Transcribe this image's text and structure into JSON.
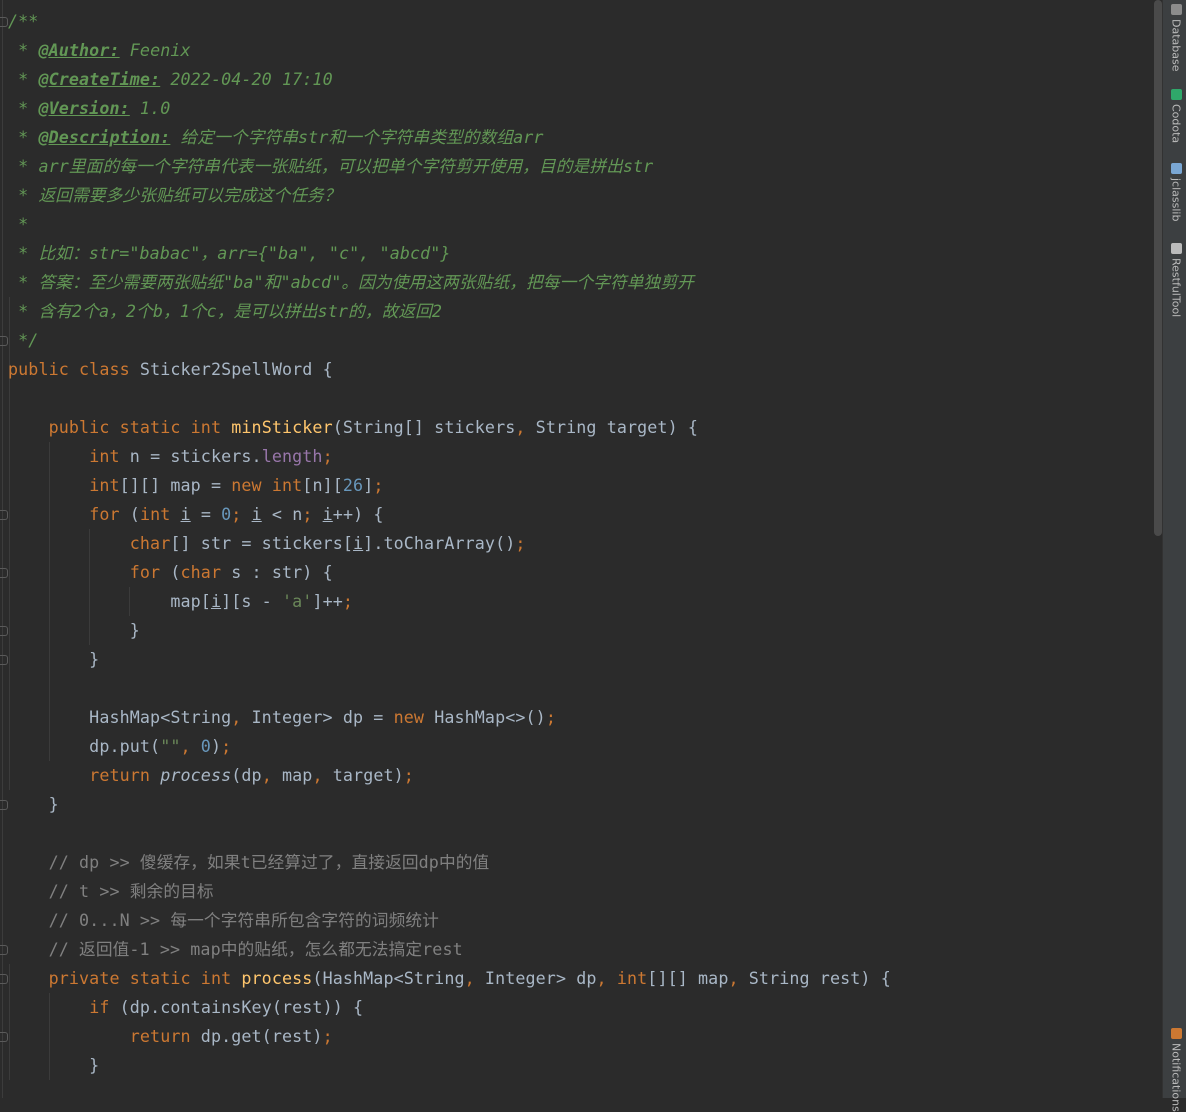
{
  "editor": {
    "lines": [
      [
        {
          "t": "/**",
          "c": "doc"
        }
      ],
      [
        {
          "t": " * ",
          "c": "doc"
        },
        {
          "t": "@Author:",
          "c": "tag"
        },
        {
          "t": " Feenix",
          "c": "doc"
        }
      ],
      [
        {
          "t": " * ",
          "c": "doc"
        },
        {
          "t": "@CreateTime:",
          "c": "tag"
        },
        {
          "t": " 2022-04-20 17:10",
          "c": "doc"
        }
      ],
      [
        {
          "t": " * ",
          "c": "doc"
        },
        {
          "t": "@Version:",
          "c": "tag"
        },
        {
          "t": " 1.0",
          "c": "doc"
        }
      ],
      [
        {
          "t": " * ",
          "c": "doc"
        },
        {
          "t": "@Description:",
          "c": "tag"
        },
        {
          "t": " 给定一个字符串str和一个字符串类型的数组arr",
          "c": "doc"
        }
      ],
      [
        {
          "t": " * arr里面的每一个字符串代表一张贴纸，可以把单个字符剪开使用，目的是拼出str",
          "c": "doc"
        }
      ],
      [
        {
          "t": " * 返回需要多少张贴纸可以完成这个任务？",
          "c": "doc"
        }
      ],
      [
        {
          "t": " *",
          "c": "doc"
        }
      ],
      [
        {
          "t": " * 比如：str=\"babac\"，arr={\"ba\", \"c\", \"abcd\"}",
          "c": "doc"
        }
      ],
      [
        {
          "t": " * 答案：至少需要两张贴纸\"ba\"和\"abcd\"。因为使用这两张贴纸，把每一个字符单独剪开",
          "c": "doc"
        }
      ],
      [
        {
          "t": " * 含有2个a，2个b，1个c，是可以拼出str的，故返回2",
          "c": "doc"
        }
      ],
      [
        {
          "t": " */",
          "c": "doc"
        }
      ],
      [
        {
          "t": "public class ",
          "c": "kw"
        },
        {
          "t": "Sticker2SpellWord {",
          "c": ""
        }
      ],
      [],
      [
        {
          "t": "    "
        },
        {
          "t": "public static int ",
          "c": "kw"
        },
        {
          "t": "minSticker",
          "c": "fn"
        },
        {
          "t": "(String[] stickers"
        },
        {
          "t": ", ",
          "c": "kw"
        },
        {
          "t": "String target) {"
        }
      ],
      [
        {
          "t": "        "
        },
        {
          "t": "int ",
          "c": "kw"
        },
        {
          "t": "n = stickers."
        },
        {
          "t": "length",
          "c": "field"
        },
        {
          "t": ";",
          "c": "kw"
        }
      ],
      [
        {
          "t": "        "
        },
        {
          "t": "int",
          "c": "kw"
        },
        {
          "t": "[][] map = "
        },
        {
          "t": "new int",
          "c": "kw"
        },
        {
          "t": "[n]["
        },
        {
          "t": "26",
          "c": "num"
        },
        {
          "t": "]"
        },
        {
          "t": ";",
          "c": "kw"
        }
      ],
      [
        {
          "t": "        "
        },
        {
          "t": "for ",
          "c": "kw"
        },
        {
          "t": "("
        },
        {
          "t": "int ",
          "c": "kw"
        },
        {
          "t": "i",
          "c": "ul"
        },
        {
          "t": " = "
        },
        {
          "t": "0",
          "c": "num"
        },
        {
          "t": "; ",
          "c": "kw"
        },
        {
          "t": "i",
          "c": "ul"
        },
        {
          "t": " < n"
        },
        {
          "t": "; ",
          "c": "kw"
        },
        {
          "t": "i",
          "c": "ul"
        },
        {
          "t": "++) {"
        }
      ],
      [
        {
          "t": "            "
        },
        {
          "t": "char",
          "c": "kw"
        },
        {
          "t": "[] str = stickers["
        },
        {
          "t": "i",
          "c": "ul"
        },
        {
          "t": "].toCharArray()"
        },
        {
          "t": ";",
          "c": "kw"
        }
      ],
      [
        {
          "t": "            "
        },
        {
          "t": "for ",
          "c": "kw"
        },
        {
          "t": "("
        },
        {
          "t": "char ",
          "c": "kw"
        },
        {
          "t": "s : str) {"
        }
      ],
      [
        {
          "t": "                map["
        },
        {
          "t": "i",
          "c": "ul"
        },
        {
          "t": "][s - "
        },
        {
          "t": "'a'",
          "c": "str"
        },
        {
          "t": "]++"
        },
        {
          "t": ";",
          "c": "kw"
        }
      ],
      [
        {
          "t": "            }"
        }
      ],
      [
        {
          "t": "        }"
        }
      ],
      [],
      [
        {
          "t": "        HashMap<String"
        },
        {
          "t": ", ",
          "c": "kw"
        },
        {
          "t": "Integer> dp = "
        },
        {
          "t": "new ",
          "c": "kw"
        },
        {
          "t": "HashMap<>()"
        },
        {
          "t": ";",
          "c": "kw"
        }
      ],
      [
        {
          "t": "        dp.put("
        },
        {
          "t": "\"\"",
          "c": "str"
        },
        {
          "t": ", ",
          "c": "kw"
        },
        {
          "t": "0",
          "c": "num"
        },
        {
          "t": ")"
        },
        {
          "t": ";",
          "c": "kw"
        }
      ],
      [
        {
          "t": "        "
        },
        {
          "t": "return ",
          "c": "kw"
        },
        {
          "t": "process",
          "c": "it"
        },
        {
          "t": "(dp"
        },
        {
          "t": ", ",
          "c": "kw"
        },
        {
          "t": "map"
        },
        {
          "t": ", ",
          "c": "kw"
        },
        {
          "t": "target)"
        },
        {
          "t": ";",
          "c": "kw"
        }
      ],
      [
        {
          "t": "    }"
        }
      ],
      [],
      [
        {
          "t": "    // dp >> 傻缓存，如果t已经算过了，直接返回dp中的值",
          "c": "cmt"
        }
      ],
      [
        {
          "t": "    // t >> 剩余的目标",
          "c": "cmt"
        }
      ],
      [
        {
          "t": "    // 0...N >> 每一个字符串所包含字符的词频统计",
          "c": "cmt"
        }
      ],
      [
        {
          "t": "    // 返回值-1 >> map中的贴纸，怎么都无法搞定rest",
          "c": "cmt"
        }
      ],
      [
        {
          "t": "    "
        },
        {
          "t": "private static int ",
          "c": "kw"
        },
        {
          "t": "process",
          "c": "fn"
        },
        {
          "t": "(HashMap<String"
        },
        {
          "t": ", ",
          "c": "kw"
        },
        {
          "t": "Integer> dp"
        },
        {
          "t": ", ",
          "c": "kw"
        },
        {
          "t": "int",
          "c": "kw"
        },
        {
          "t": "[][] map"
        },
        {
          "t": ", ",
          "c": "kw"
        },
        {
          "t": "String rest) {"
        }
      ],
      [
        {
          "t": "        "
        },
        {
          "t": "if ",
          "c": "kw"
        },
        {
          "t": "(dp.containsKey(rest)) {"
        }
      ],
      [
        {
          "t": "            "
        },
        {
          "t": "return ",
          "c": "kw"
        },
        {
          "t": "dp.get(rest)"
        },
        {
          "t": ";",
          "c": "kw"
        }
      ],
      [
        {
          "t": "        }"
        }
      ]
    ]
  },
  "sidebar": {
    "items": [
      {
        "label": "Database",
        "icon": "database-icon",
        "color": "#8c8c8c"
      },
      {
        "label": "Codota",
        "icon": "codota-icon",
        "color": "#2fa86a"
      },
      {
        "label": "jclasslib",
        "icon": "jclasslib-icon",
        "color": "#7aa7d4"
      },
      {
        "label": "RestfulTool",
        "icon": "restfultool-icon",
        "color": "#bbbbbb"
      },
      {
        "label": "Notifications",
        "icon": "notifications-icon",
        "color": "#cc7832"
      }
    ]
  }
}
